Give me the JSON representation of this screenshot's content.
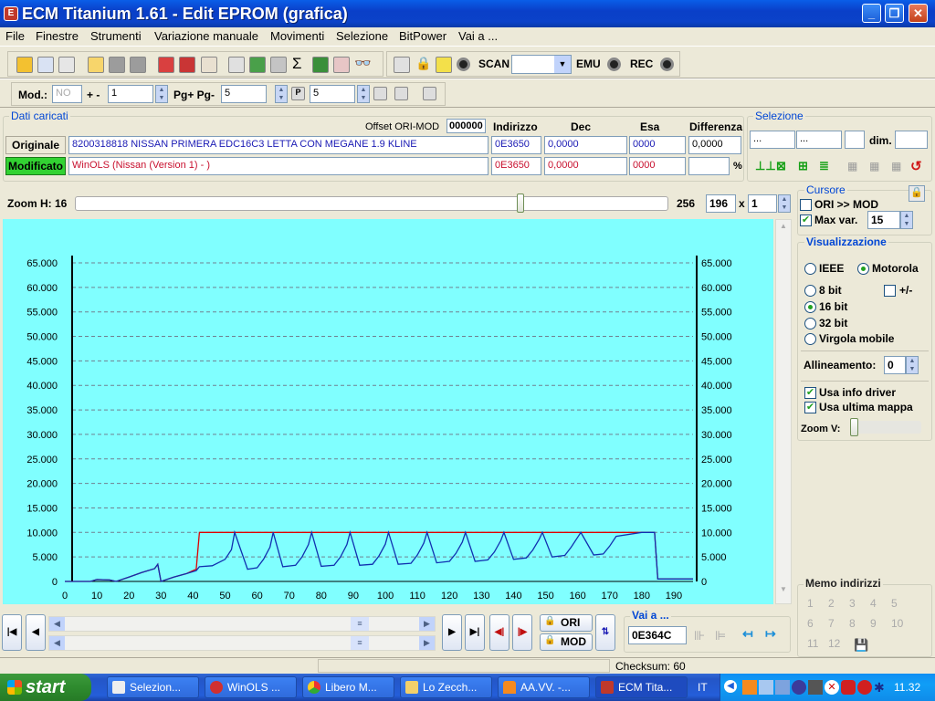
{
  "window": {
    "title": "ECM Titanium 1.61 - Edit EPROM (grafica)",
    "icon": "ecm-app-icon"
  },
  "menu": [
    "File",
    "Finestre",
    "Strumenti",
    "Variazione manuale",
    "Movimenti",
    "Selezione",
    "BitPower",
    "Vai a ..."
  ],
  "toolbar1": {
    "scan_label": "SCAN",
    "emu_label": "EMU",
    "rec_label": "REC",
    "scan_value": ""
  },
  "toolbar2": {
    "mod_label": "Mod.:",
    "mod_value": "NO",
    "plusminus_label": "+ -",
    "plusminus_value": "1",
    "pg_label": "Pg+ Pg-",
    "pg_value": "5",
    "p_value": "5"
  },
  "dati": {
    "title": "Dati caricati",
    "offset_label": "Offset ORI-MOD",
    "offset_value": "000000",
    "col_indirizzo": "Indirizzo",
    "col_dec": "Dec",
    "col_esa": "Esa",
    "col_diff": "Differenza",
    "originale": {
      "label": "Originale",
      "desc": "8200318818 NISSAN PRIMERA EDC16C3 LETTA CON MEGANE 1.9 KLINE",
      "addr": "0E3650",
      "dec": "0,0000",
      "esa": "0000",
      "diff": "0,0000"
    },
    "modificato": {
      "label": "Modificato",
      "desc": "WinOLS (Nissan (Version 1) - )",
      "addr": "0E3650",
      "dec": "0,0000",
      "esa": "0000",
      "diff": "",
      "pct": "%"
    }
  },
  "selezione": {
    "title": "Selezione",
    "f1": "...",
    "f2": "...",
    "f3": "",
    "dim_label": "dim.",
    "dim_value": ""
  },
  "zoom": {
    "label": "Zoom H: 16",
    "max": "256",
    "w": "196",
    "x": "x",
    "h": "1",
    "position": 0.75
  },
  "cursore": {
    "title": "Cursore",
    "ori_mod": "ORI >> MOD",
    "ori_mod_checked": false,
    "maxvar": "Max var.",
    "maxvar_checked": true,
    "maxvar_value": "15"
  },
  "visual": {
    "title": "Visualizzazione",
    "ieee": "IEEE",
    "motorola": "Motorola",
    "b8": "8 bit",
    "b16": "16 bit",
    "b32": "32 bit",
    "virgola": "Virgola mobile",
    "plusminus": "+/-",
    "allineamento": "Allineamento:",
    "allineamento_value": "0",
    "usa_driver": "Usa info driver",
    "usa_mappa": "Usa ultima mappa",
    "zoomv": "Zoom V:"
  },
  "memo": {
    "title": "Memo indirizzi",
    "numbers": [
      "1",
      "2",
      "3",
      "4",
      "5",
      "6",
      "7",
      "8",
      "9",
      "10",
      "11",
      "12"
    ]
  },
  "bottom": {
    "ori": "ORI",
    "mod": "MOD",
    "vai_label": "Vai a ...",
    "vai_value": "0E364C"
  },
  "status": {
    "checksum": "Checksum: 60"
  },
  "taskbar": {
    "start": "start",
    "tasks": [
      "Selezion...",
      "WinOLS ...",
      "Libero M...",
      "Lo Zecch...",
      "AA.VV. -...",
      "ECM Tita..."
    ],
    "lang": "IT",
    "clock": "11.32"
  },
  "colors": {
    "plot_bg": "#80ffff",
    "ori": "#e00000",
    "mod": "#1030b0",
    "grid": "#708090"
  },
  "chart_data": {
    "type": "line",
    "ylim": [
      0,
      65000
    ],
    "xlim": [
      0,
      196
    ],
    "yticks": [
      "0",
      "5.000",
      "10.000",
      "15.000",
      "20.000",
      "25.000",
      "30.000",
      "35.000",
      "40.000",
      "45.000",
      "50.000",
      "55.000",
      "60.000",
      "65.000"
    ],
    "xticks": [
      "0",
      "10",
      "20",
      "30",
      "40",
      "50",
      "60",
      "70",
      "80",
      "90",
      "100",
      "110",
      "120",
      "130",
      "140",
      "150",
      "160",
      "170",
      "180",
      "190"
    ],
    "series": [
      {
        "color": "#e00000",
        "x": [
          0,
          8,
          10,
          14,
          16,
          20,
          24,
          28,
          29,
          30,
          34,
          38,
          41,
          42,
          48,
          52,
          55,
          60,
          65,
          70,
          75,
          80,
          85,
          90,
          95,
          100,
          105,
          110,
          115,
          120,
          125,
          130,
          135,
          140,
          145,
          150,
          155,
          160,
          165,
          170,
          175,
          180,
          184,
          185,
          196
        ],
        "y": [
          0,
          0,
          400,
          300,
          0,
          900,
          1800,
          2600,
          3500,
          0,
          900,
          1600,
          2500,
          10000,
          10000,
          10000,
          10000,
          10000,
          10000,
          10000,
          10000,
          10000,
          10000,
          10000,
          10000,
          10000,
          10000,
          10000,
          10000,
          10000,
          10000,
          10000,
          10000,
          10000,
          10000,
          10000,
          10000,
          10000,
          10000,
          10000,
          10000,
          10000,
          10000,
          500,
          500
        ]
      },
      {
        "color": "#1030b0",
        "x": [
          0,
          8,
          10,
          14,
          16,
          20,
          24,
          28,
          29,
          30,
          34,
          38,
          41,
          42,
          46,
          50,
          52,
          53,
          57,
          60,
          62,
          64,
          65,
          68,
          72,
          74,
          76,
          77,
          80,
          84,
          86,
          88,
          89,
          92,
          96,
          98,
          100,
          101,
          104,
          108,
          110,
          112,
          113,
          116,
          120,
          122,
          124,
          125,
          128,
          132,
          134,
          136,
          137,
          140,
          144,
          146,
          148,
          149,
          152,
          156,
          158,
          160,
          161,
          165,
          168,
          170,
          172,
          180,
          184,
          185,
          196
        ],
        "y": [
          0,
          0,
          400,
          300,
          0,
          900,
          1800,
          2600,
          3500,
          0,
          900,
          1600,
          2200,
          3000,
          3200,
          4500,
          6500,
          10000,
          2500,
          2800,
          4500,
          7000,
          10000,
          3000,
          3300,
          5000,
          7500,
          10000,
          3100,
          3300,
          5000,
          7500,
          10000,
          3300,
          3500,
          5200,
          7600,
          10000,
          3500,
          3700,
          5400,
          7800,
          10000,
          3800,
          4100,
          5700,
          8000,
          10000,
          4100,
          4400,
          6000,
          8300,
          10000,
          4500,
          4800,
          6400,
          8600,
          10000,
          5000,
          5300,
          7000,
          9000,
          10000,
          5400,
          5600,
          7200,
          9200,
          10000,
          10000,
          500,
          500
        ]
      }
    ]
  }
}
